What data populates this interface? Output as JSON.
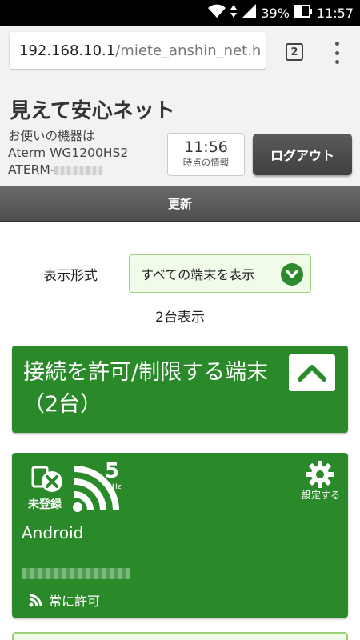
{
  "status_bar": {
    "battery": "39%",
    "time": "11:57"
  },
  "browser": {
    "url_host": "192.168.10.1",
    "url_path": "/miete_anshin_net.h",
    "tab_count": "2"
  },
  "header": {
    "title": "見えて安心ネット",
    "device_label": "お使いの機器は",
    "model": "Aterm WG1200HS2",
    "ssid_prefix": "ATERM-",
    "time_value": "11:56",
    "time_label": "時点の情報",
    "logout": "ログアウト"
  },
  "refresh_label": "更新",
  "display": {
    "format_label": "表示形式",
    "selected_option": "すべての端末を表示",
    "count_text": "2台表示"
  },
  "section": {
    "title": "接続を許可/制限する端末（2台）"
  },
  "device": {
    "status": "未登録",
    "band": "5",
    "band_unit": "GHz",
    "settings": "設定する",
    "name": "Android",
    "permission": "常に許可"
  }
}
